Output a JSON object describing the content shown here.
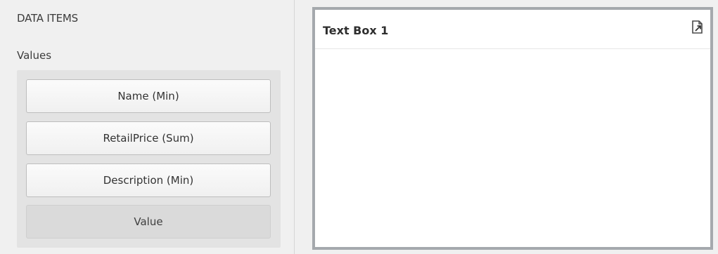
{
  "data_items_panel": {
    "section_title": "DATA ITEMS",
    "group_label": "Values",
    "items": [
      {
        "label": "Name (Min)"
      },
      {
        "label": "RetailPrice (Sum)"
      },
      {
        "label": "Description (Min)"
      }
    ],
    "placeholder_label": "Value"
  },
  "dashboard_item": {
    "title": "Text Box 1",
    "header_icon": "export-icon"
  },
  "colors": {
    "background": "#f0f0f0",
    "well": "#e3e3e3",
    "frame_border": "#a5a9ad",
    "card_background": "#ffffff"
  }
}
